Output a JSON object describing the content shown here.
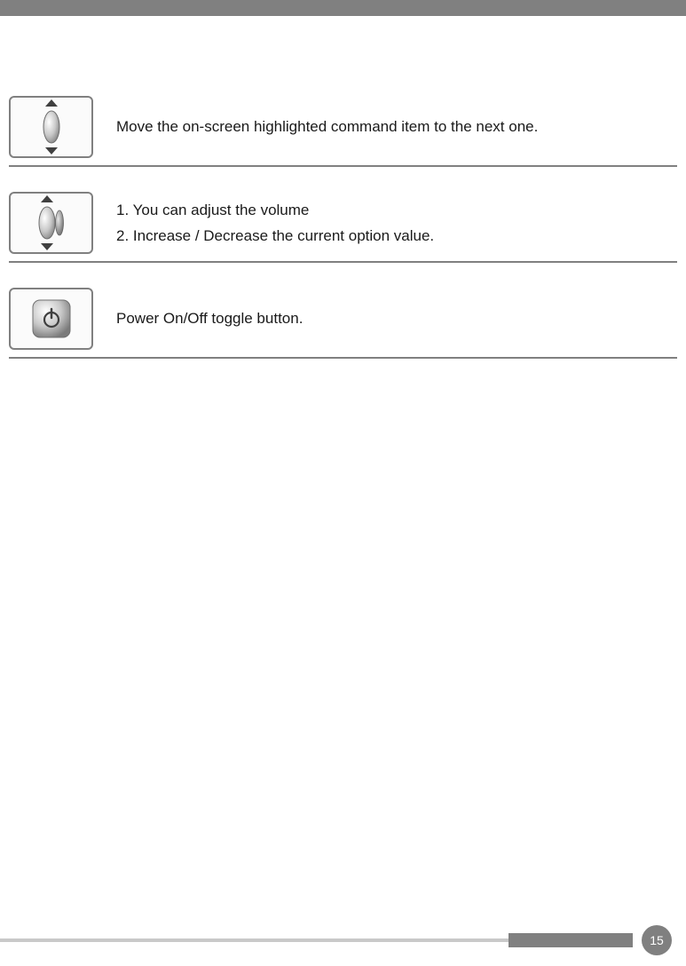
{
  "rows": [
    {
      "description_lines": [
        "Move the on-screen highlighted command item to the next one."
      ]
    },
    {
      "description_lines": [
        "1. You can adjust the volume",
        "2. Increase / Decrease the current option value."
      ]
    },
    {
      "description_lines": [
        "Power On/Off toggle button."
      ]
    }
  ],
  "page_number": "15"
}
